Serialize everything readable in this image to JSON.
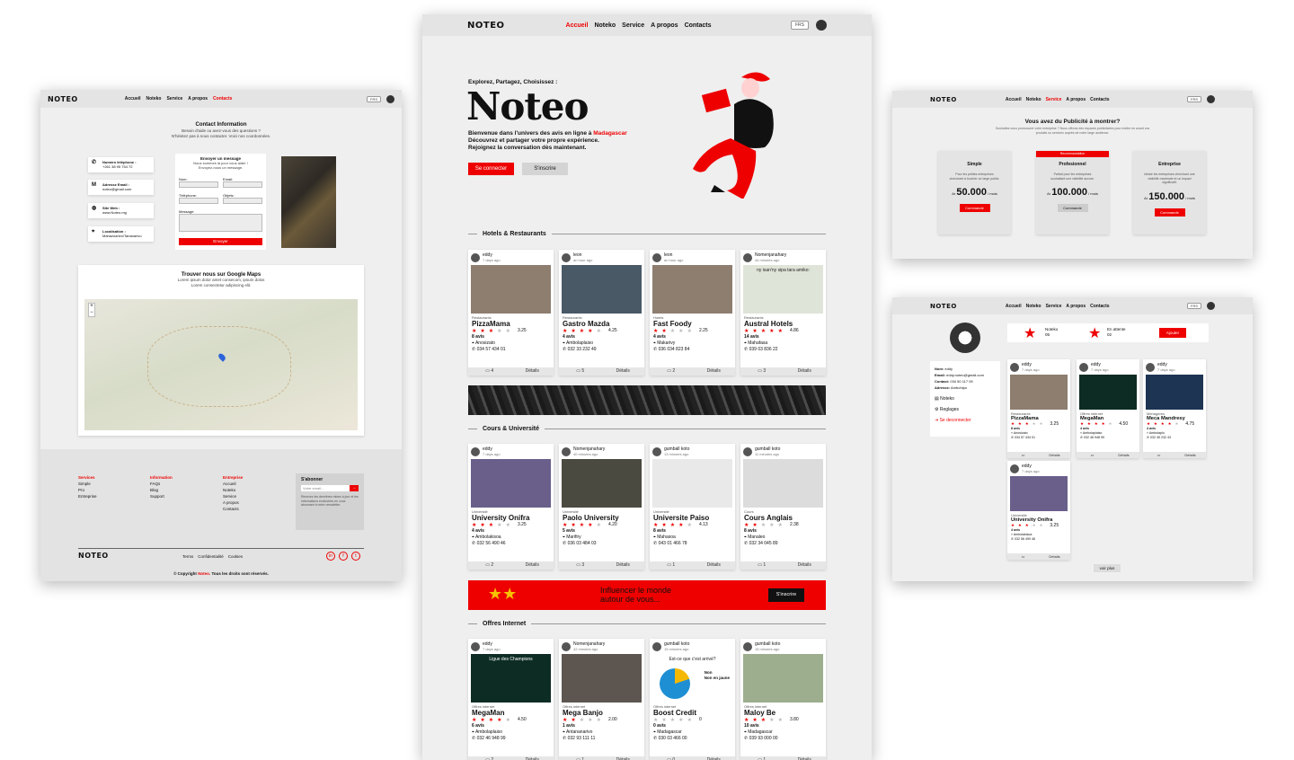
{
  "brand": {
    "logo": "NOTEO",
    "lang": "FRS"
  },
  "nav": {
    "accueil": "Accueil",
    "noteko": "Noteko",
    "service": "Service",
    "apropos": "A propos",
    "contacts": "Contacts"
  },
  "hero": {
    "kicker": "Explorez, Partagez, Choisissez :",
    "title": "Noteo",
    "line1": "Bienvenue dans l'univers des avis en ligne à",
    "highlight": "Madagascar",
    "line2": "Découvrez et partager votre propre expérience.",
    "line3": "Rejoignez la conversation dès maintenant.",
    "cta1": "Se connecter",
    "cta2": "S'inscrire"
  },
  "sections": {
    "hotels": "Hotels & Restaurants",
    "cours": "Cours & Université",
    "offres": "Offres Internet"
  },
  "footer_labels": {
    "details": "Détails"
  },
  "hotels": [
    {
      "user": "eddy",
      "time": "7 days ago",
      "cat": "Restaurants",
      "title": "PizzaMama",
      "stars": 3,
      "score": "3.25",
      "avis": "8 avis",
      "loc": "Anosizato",
      "tel": "034 57 434 01",
      "comments": "4",
      "img": "#8d7e70"
    },
    {
      "user": "leon",
      "time": "an hour ago",
      "cat": "Restaurants",
      "title": "Gastro Mazda",
      "stars": 4,
      "score": "4.25",
      "avis": "4 avis",
      "loc": "Ambolaplaiso",
      "tel": "032 33 232 49",
      "comments": "5",
      "img": "#4a5966"
    },
    {
      "user": "leon",
      "time": "an hour ago",
      "cat": "Hotels",
      "title": "Fast Foody",
      "stars": 2,
      "score": "2.25",
      "avis": "4 avis",
      "loc": "Makarivy",
      "tel": "036 034 823 84",
      "comments": "2",
      "img": "#8d7e70"
    },
    {
      "user": "Nomenjanahary",
      "time": "44 minutes ago",
      "cat": "Restaurants",
      "title": "Austral Hotels",
      "stars": 5,
      "score": "4.86",
      "avis": "14 avis",
      "loc": "Mahafasa",
      "tel": "039 03 836 22",
      "comments": "3",
      "img": "#dfe4d8",
      "caption": "ny isan'ny sipa tara amiko:"
    }
  ],
  "cours": [
    {
      "user": "eddy",
      "time": "7 days ago",
      "cat": "Université",
      "title": "University Onifra",
      "stars": 3,
      "score": "3.25",
      "avis": "4 avis",
      "loc": "Ambolakisoa",
      "tel": "032 56 490 46",
      "comments": "2",
      "img": "#6a5f8a"
    },
    {
      "user": "Nomenjanahary",
      "time": "40 minutes ago",
      "cat": "Université",
      "title": "Paolo University",
      "stars": 4,
      "score": "4.20",
      "avis": "5 avis",
      "loc": "Marifiry",
      "tel": "036 03 484 03",
      "comments": "3",
      "img": "#4b4a40"
    },
    {
      "user": "gumball koto",
      "time": "13 minutes ago",
      "cat": "Université",
      "title": "Universite Paiso",
      "stars": 4,
      "score": "4.13",
      "avis": "8 avis",
      "loc": "Mahasoa",
      "tel": "043 01 466 78",
      "comments": "1",
      "img": "#e9e9e9"
    },
    {
      "user": "gumball koto",
      "time": "11 minutes ago",
      "cat": "Cours",
      "title": "Cours Anglais",
      "stars": 2,
      "score": "2.38",
      "avis": "8 avis",
      "loc": "Manaleo",
      "tel": "032 34 045 89",
      "comments": "1",
      "img": "#dcdcdc"
    }
  ],
  "offres": [
    {
      "user": "eddy",
      "time": "7 days ago",
      "cat": "Offres internet",
      "title": "MegaMan",
      "stars": 4,
      "score": "4.50",
      "avis": "6 avis",
      "loc": "Ambolaplaiso",
      "tel": "032 46 948 99",
      "comments": "2",
      "img": "#0d2c24",
      "caption": "Ligue des Champions"
    },
    {
      "user": "Nomenjanahary",
      "time": "42 minutes ago",
      "cat": "Offres internet",
      "title": "Mega Banjo",
      "stars": 2,
      "score": "2.00",
      "avis": "1 avis",
      "loc": "Antananarivo",
      "tel": "032 93 111 11",
      "comments": "1",
      "img": "#5d5650"
    },
    {
      "user": "gumball koto",
      "time": "15 minutes ago",
      "cat": "Offres internet",
      "title": "Boost Credit",
      "stars": 0,
      "score": "0",
      "avis": "0 avis",
      "loc": "Madagascar",
      "tel": "030 03 466 00",
      "comments": "0",
      "img": "#ffffff",
      "caption": "Est-ce que c'est arrivé?",
      "leg1": "Non",
      "leg2": "Non en jaune"
    },
    {
      "user": "gumball koto",
      "time": "15 minutes ago",
      "cat": "Offres internet",
      "title": "Maloy Be",
      "stars": 3,
      "score": "3.80",
      "avis": "10 avis",
      "loc": "Madagascar",
      "tel": "039 93 000 00",
      "comments": "1",
      "img": "#9cae8d"
    }
  ],
  "banner": {
    "text1": "Influencer le monde",
    "text2": "autour de vous...",
    "btn": "S'inscrire"
  },
  "contact": {
    "title": "Contact Information",
    "sub1": "Besoin d'aide ou avez-vous des questions ?",
    "sub2": "N'hésitez pas à nous contacter. Voici nos coordonnées.",
    "items": [
      {
        "label": "Numéro téléphone :",
        "value": "+261 38 95 754 72"
      },
      {
        "label": "Adresse Email :",
        "value": "noteo@gmail.com"
      },
      {
        "label": "Site Web :",
        "value": "www.Noteo.mg"
      },
      {
        "label": "Localisation :",
        "value": "Mahazoarivo/Tananarivo"
      }
    ],
    "form": {
      "title": "Envoyer un message",
      "sub1": "Nous sommes là pour vous aider !",
      "sub2": "Envoyez-nous un message.",
      "nom": "Nom:",
      "email": "Email:",
      "tel": "Téléphone:",
      "objet": "Objets:",
      "message": "Message:",
      "send": "Envoyer"
    },
    "maps_title": "Trouver nous sur Google Maps",
    "maps_sub1": "Lorem ipsum dolor amet consecom, ipsum dolos",
    "maps_sub2": "Lorem consectetur adipiscing elit.",
    "footer": {
      "c1h": "Services",
      "c1": [
        "Simple",
        "Pro",
        "Entreprise"
      ],
      "c2h": "Information",
      "c2": [
        "FAQs",
        "Blog",
        "Support"
      ],
      "c3h": "Entreprise",
      "c3": [
        "Accueil",
        "Noteko",
        "Service",
        "A propos",
        "Contacts"
      ],
      "sub_title": "S'abonner",
      "sub_ph": "Votre email...",
      "sub_text": "Recevez les dernières mises à jour et les informations exclusives en vous abonnant à notre newsletter.",
      "links": [
        "Terms",
        "Confidentialité",
        "Cookies"
      ],
      "copy1": "© Copyright",
      "copy_brand": "Noteo.",
      "copy2": "Tous les droits sont réservés."
    }
  },
  "pub": {
    "title": "Vous avez du Publicité à montrer?",
    "sub": "Souhaitez-vous promouvoir votre entreprise ? Nous offrons des espaces publicitaires pour mettre en avant vos produits ou services auprès de notre large audience.",
    "plans": [
      {
        "name": "Simple",
        "desc": "Pour les petites entreprises cherchant à toucher un large public.",
        "cur": "Ar",
        "price": "50.000",
        "per": "/ mois",
        "btn": "Commande",
        "tag": ""
      },
      {
        "name": "Profesionnel",
        "desc": "Parfait pour les entreprises souhaitant une visibilité accrue.",
        "cur": "Ar",
        "price": "100.000",
        "per": "/ mois",
        "btn": "Commande",
        "tag": "Recommandation"
      },
      {
        "name": "Entreprise",
        "desc": "Idéale les entreprises cherchant une visibilité maximale et un impact significatif.",
        "cur": "Ar",
        "price": "150.000",
        "per": "/ mois",
        "btn": "Commande",
        "tag": ""
      }
    ]
  },
  "profile": {
    "stat1_label": "Noteko",
    "stat1_val": "05",
    "stat2_label": "En attente",
    "stat2_val": "02",
    "add": "Ajouter",
    "nom": "Nom:",
    "nom_v": "eddy",
    "email": "Email:",
    "email_v": "eddy.noteo@gmail.com",
    "contact": "Contact:",
    "contact_v": "034 50 117 09",
    "adresse": "Adresse:",
    "adresse_v": "Ambohipo",
    "menu1": "Noteko",
    "menu2": "Reglages",
    "menu3": "Se deconnecter",
    "more": "voir plus",
    "cards": [
      {
        "user": "eddy",
        "time": "7 days ago",
        "cat": "Restaurants",
        "title": "PizzaMama",
        "stars": 3,
        "score": "3.25",
        "avis": "8 avis",
        "loc": "Anosizato",
        "tel": "034 57 434 01",
        "img": "#8d7e70"
      },
      {
        "user": "eddy",
        "time": "7 days ago",
        "cat": "Offres internet",
        "title": "MegaMan",
        "stars": 4,
        "score": "4.50",
        "avis": "4 avis",
        "loc": "Ambolaplaiso",
        "tel": "032 46 948 99",
        "img": "#0d2c24"
      },
      {
        "user": "eddy",
        "time": "7 days ago",
        "cat": "Ménagères",
        "title": "Meca Mandresy",
        "stars": 4,
        "score": "4.75",
        "avis": "4 avis",
        "loc": "Ambolaplo",
        "tel": "032 45 232 43",
        "img": "#1d3453"
      },
      {
        "user": "eddy",
        "time": "7 days ago",
        "cat": "Université",
        "title": "University Onifra",
        "stars": 3,
        "score": "3.25",
        "avis": "4 avis",
        "loc": "Ambolakisoa",
        "tel": "032 56 490 46",
        "img": "#6a5f8a"
      }
    ]
  }
}
